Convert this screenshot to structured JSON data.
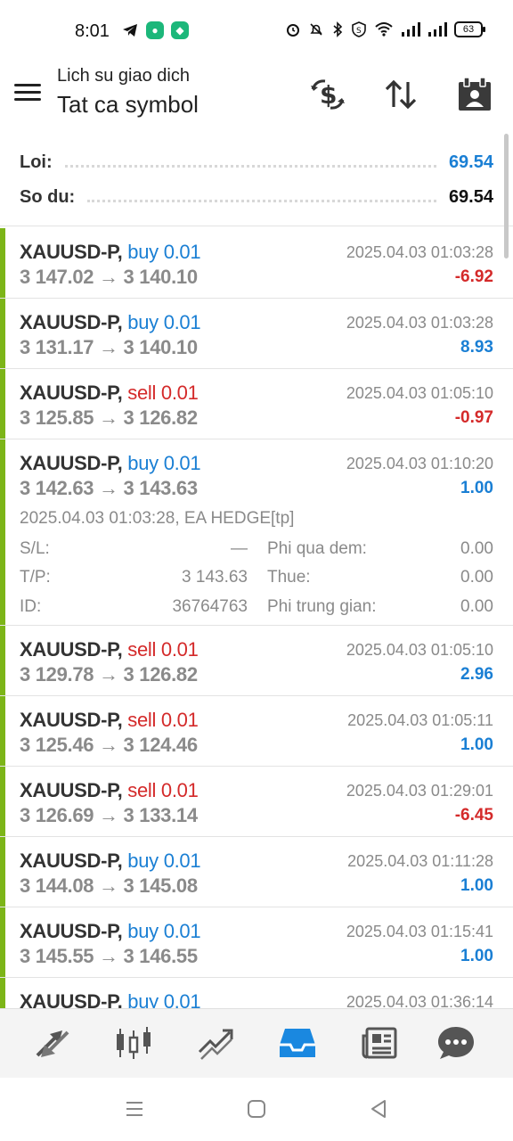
{
  "status_bar": {
    "time": "8:01",
    "battery": "63"
  },
  "header": {
    "subtitle": "Lich su giao dich",
    "title": "Tat ca symbol",
    "icons": [
      "currency-exchange-icon",
      "sort-icon",
      "calendar-icon"
    ]
  },
  "summary": {
    "profit_label": "Loi:",
    "profit_value": "69.54",
    "balance_label": "So du:",
    "balance_value": "69.54"
  },
  "trades": [
    {
      "symbol": "XAUUSD-P,",
      "side": "buy",
      "volume": "0.01",
      "prices": "3 147.02 → 3 140.10",
      "time": "2025.04.03 01:03:28",
      "profit": "-6.92"
    },
    {
      "symbol": "XAUUSD-P,",
      "side": "buy",
      "volume": "0.01",
      "prices": "3 131.17 → 3 140.10",
      "time": "2025.04.03 01:03:28",
      "profit": "8.93"
    },
    {
      "symbol": "XAUUSD-P,",
      "side": "sell",
      "volume": "0.01",
      "prices": "3 125.85 → 3 126.82",
      "time": "2025.04.03 01:05:10",
      "profit": "-0.97"
    },
    {
      "symbol": "XAUUSD-P,",
      "side": "buy",
      "volume": "0.01",
      "prices": "3 142.63 → 3 143.63",
      "time": "2025.04.03 01:10:20",
      "profit": "1.00",
      "details": {
        "open_info": "2025.04.03 01:03:28, EA HEDGE[tp]",
        "sl_label": "S/L:",
        "sl_value": "—",
        "swap_label": "Phi qua dem:",
        "swap_value": "0.00",
        "tp_label": "T/P:",
        "tp_value": "3 143.63",
        "tax_label": "Thue:",
        "tax_value": "0.00",
        "id_label": "ID:",
        "id_value": "36764763",
        "commission_label": "Phi trung gian:",
        "commission_value": "0.00"
      }
    },
    {
      "symbol": "XAUUSD-P,",
      "side": "sell",
      "volume": "0.01",
      "prices": "3 129.78 → 3 126.82",
      "time": "2025.04.03 01:05:10",
      "profit": "2.96"
    },
    {
      "symbol": "XAUUSD-P,",
      "side": "sell",
      "volume": "0.01",
      "prices": "3 125.46 → 3 124.46",
      "time": "2025.04.03 01:05:11",
      "profit": "1.00"
    },
    {
      "symbol": "XAUUSD-P,",
      "side": "sell",
      "volume": "0.01",
      "prices": "3 126.69 → 3 133.14",
      "time": "2025.04.03 01:29:01",
      "profit": "-6.45"
    },
    {
      "symbol": "XAUUSD-P,",
      "side": "buy",
      "volume": "0.01",
      "prices": "3 144.08 → 3 145.08",
      "time": "2025.04.03 01:11:28",
      "profit": "1.00"
    },
    {
      "symbol": "XAUUSD-P,",
      "side": "buy",
      "volume": "0.01",
      "prices": "3 145.55 → 3 146.55",
      "time": "2025.04.03 01:15:41",
      "profit": "1.00"
    },
    {
      "symbol": "XAUUSD-P,",
      "side": "buy",
      "volume": "0.01",
      "prices": "",
      "time": "2025.04.03 01:36:14",
      "profit": ""
    }
  ],
  "bottom_nav": [
    "quotes-icon",
    "chart-icon",
    "trade-icon",
    "history-icon",
    "news-icon",
    "messages-icon"
  ],
  "colors": {
    "buy": "#1a7fd4",
    "sell": "#d42a2a",
    "profit_positive": "#1a7fd4",
    "profit_negative": "#d42a2a",
    "accent_bar": "#7cb518",
    "active_tab": "#1a88e0"
  }
}
